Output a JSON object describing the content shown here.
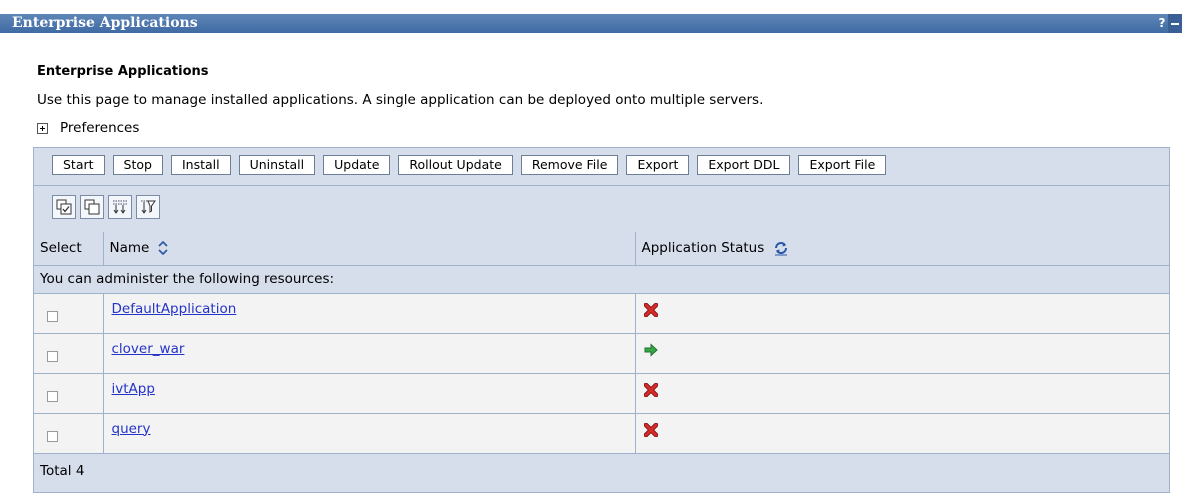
{
  "window": {
    "title": "Enterprise Applications",
    "help_label": "?"
  },
  "page": {
    "heading": "Enterprise Applications",
    "description": "Use this page to manage installed applications. A single application can be deployed onto multiple servers.",
    "preferences_label": "Preferences"
  },
  "toolbar": {
    "buttons": [
      "Start",
      "Stop",
      "Install",
      "Uninstall",
      "Update",
      "Rollout Update",
      "Remove File",
      "Export",
      "Export DDL",
      "Export File"
    ]
  },
  "icon_toolbar": {
    "icons": [
      "select-all-icon",
      "deselect-all-icon",
      "show-filter-icon",
      "clear-filter-icon"
    ]
  },
  "table": {
    "columns": {
      "select": "Select",
      "name": "Name",
      "status": "Application Status"
    },
    "resources_note": "You can administer the following resources:",
    "rows": [
      {
        "name": "DefaultApplication",
        "status": "stopped",
        "status_icon": "red-x-icon"
      },
      {
        "name": "clover_war",
        "status": "started",
        "status_icon": "green-arrow-icon"
      },
      {
        "name": "ivtApp",
        "status": "stopped",
        "status_icon": "red-x-icon"
      },
      {
        "name": "query",
        "status": "stopped",
        "status_icon": "red-x-icon"
      }
    ],
    "total_label": "Total 4"
  },
  "colors": {
    "title_bar": "#4a74ab",
    "panel_bg": "#d5deea",
    "row_bg": "#f3f3f3",
    "link": "#2433c8",
    "stopped": "#cc2222",
    "started": "#2a9a3a"
  }
}
